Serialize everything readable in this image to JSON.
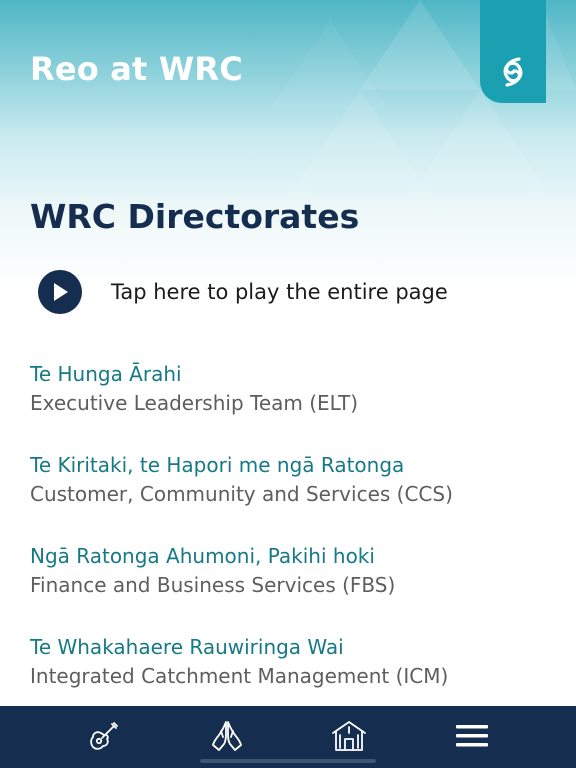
{
  "header": {
    "app_title": "Reo at WRC"
  },
  "page": {
    "title": "WRC Directorates",
    "play_all_label": "Tap here to play the entire page"
  },
  "directorates": [
    {
      "maori": "Te Hunga Ārahi",
      "english": "Executive Leadership Team (ELT)"
    },
    {
      "maori": "Te Kiritaki, te Hapori me ngā Ratonga",
      "english": "Customer, Community and Services (CCS)"
    },
    {
      "maori": "Ngā Ratonga Ahumoni, Pakihi hoki",
      "english": "Finance and Business Services (FBS)"
    },
    {
      "maori": "Te Whakahaere Rauwiringa Wai",
      "english": "Integrated Catchment Management (ICM)"
    }
  ],
  "tabbar": {
    "icons": [
      "guitar-icon",
      "praying-hands-icon",
      "house-icon",
      "menu-icon"
    ]
  },
  "colors": {
    "navy": "#152d4e",
    "teal": "#157a86",
    "logo_teal": "#1aa0b0",
    "grey_text": "#5e5e5e"
  }
}
